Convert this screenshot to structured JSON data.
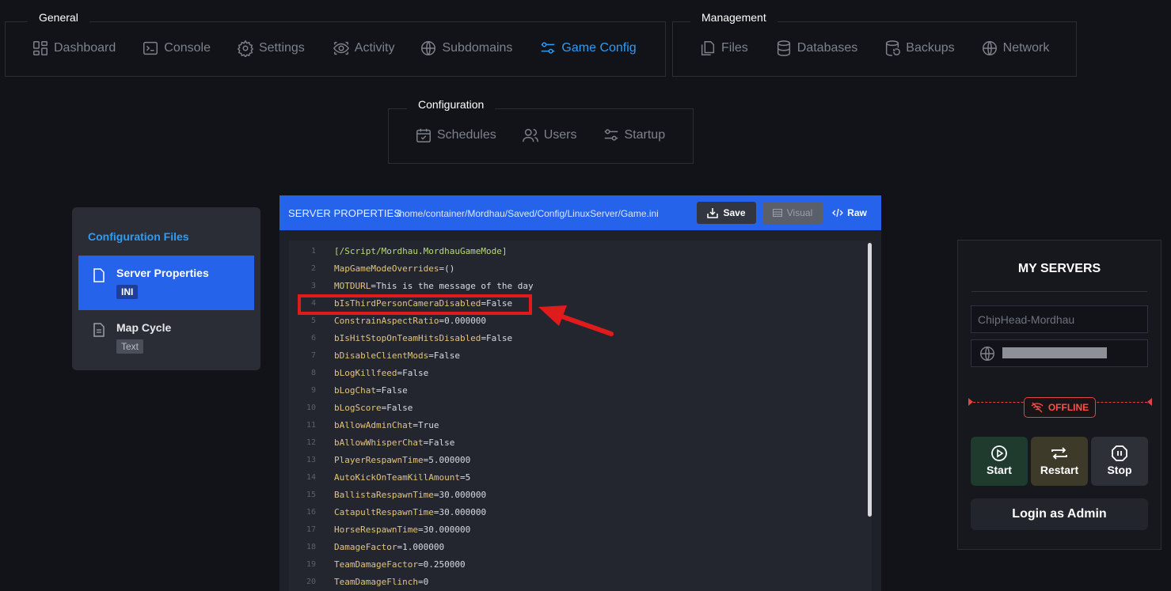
{
  "nav": {
    "general": {
      "label": "General",
      "items": [
        {
          "label": "Dashboard",
          "icon": "dashboard-icon"
        },
        {
          "label": "Console",
          "icon": "terminal-icon"
        },
        {
          "label": "Settings",
          "icon": "gear-icon"
        },
        {
          "label": "Activity",
          "icon": "eye-icon"
        },
        {
          "label": "Subdomains",
          "icon": "globe-icon"
        },
        {
          "label": "Game Config",
          "icon": "sliders-icon",
          "active": true
        }
      ]
    },
    "management": {
      "label": "Management",
      "items": [
        {
          "label": "Files",
          "icon": "files-icon"
        },
        {
          "label": "Databases",
          "icon": "database-icon"
        },
        {
          "label": "Backups",
          "icon": "backup-icon"
        },
        {
          "label": "Network",
          "icon": "globe-icon"
        }
      ]
    },
    "configuration": {
      "label": "Configuration",
      "items": [
        {
          "label": "Schedules",
          "icon": "calendar-icon"
        },
        {
          "label": "Users",
          "icon": "users-icon"
        },
        {
          "label": "Startup",
          "icon": "toggles-icon"
        }
      ]
    }
  },
  "config_files": {
    "title": "Configuration Files",
    "items": [
      {
        "name": "Server Properties",
        "badge": "INI",
        "active": true
      },
      {
        "name": "Map Cycle",
        "badge": "Text",
        "active": false
      }
    ]
  },
  "editor": {
    "title": "SERVER PROPERTIES",
    "path": "/home/container/Mordhau/Saved/Config/LinuxServer/Game.ini",
    "save_label": "Save",
    "visual_label": "Visual",
    "raw_label": "Raw",
    "lines": [
      {
        "n": "1",
        "key": "[/Script/Mordhau.MordhauGameMode]",
        "val": ""
      },
      {
        "n": "2",
        "key": "MapGameModeOverrides",
        "val": "=()"
      },
      {
        "n": "3",
        "key": "MOTDURL",
        "val": "=This is the message of the day"
      },
      {
        "n": "4",
        "key": "bIsThirdPersonCameraDisabled",
        "val": "=False"
      },
      {
        "n": "5",
        "key": "ConstrainAspectRatio",
        "val": "=0.000000"
      },
      {
        "n": "6",
        "key": "bIsHitStopOnTeamHitsDisabled",
        "val": "=False"
      },
      {
        "n": "7",
        "key": "bDisableClientMods",
        "val": "=False"
      },
      {
        "n": "8",
        "key": "bLogKillfeed",
        "val": "=False"
      },
      {
        "n": "9",
        "key": "bLogChat",
        "val": "=False"
      },
      {
        "n": "10",
        "key": "bLogScore",
        "val": "=False"
      },
      {
        "n": "11",
        "key": "bAllowAdminChat",
        "val": "=True"
      },
      {
        "n": "12",
        "key": "bAllowWhisperChat",
        "val": "=False"
      },
      {
        "n": "13",
        "key": "PlayerRespawnTime",
        "val": "=5.000000"
      },
      {
        "n": "14",
        "key": "AutoKickOnTeamKillAmount",
        "val": "=5"
      },
      {
        "n": "15",
        "key": "BallistaRespawnTime",
        "val": "=30.000000"
      },
      {
        "n": "16",
        "key": "CatapultRespawnTime",
        "val": "=30.000000"
      },
      {
        "n": "17",
        "key": "HorseRespawnTime",
        "val": "=30.000000"
      },
      {
        "n": "18",
        "key": "DamageFactor",
        "val": "=1.000000"
      },
      {
        "n": "19",
        "key": "TeamDamageFactor",
        "val": "=0.250000"
      },
      {
        "n": "20",
        "key": "TeamDamageFlinch",
        "val": "=0"
      }
    ]
  },
  "servers": {
    "title": "MY SERVERS",
    "server_name": "ChipHead-Mordhau",
    "status": "OFFLINE",
    "start_label": "Start",
    "restart_label": "Restart",
    "stop_label": "Stop",
    "login_label": "Login as Admin"
  },
  "colors": {
    "accent": "#2f9cf4",
    "header_blue": "#2563eb",
    "annotation_red": "#e01b1b",
    "offline_red": "#ff4d4d"
  }
}
